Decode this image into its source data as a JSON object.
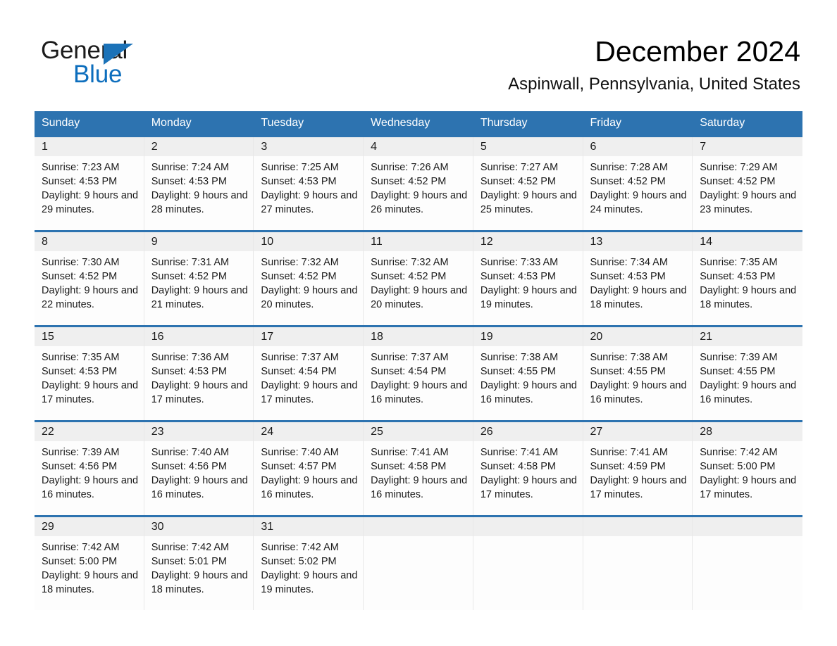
{
  "brand": {
    "logo_line1": "General",
    "logo_line2": "Blue",
    "logo_triangle_color": "#1b72b8",
    "logo_blue_text_color": "#0d6ebd"
  },
  "header": {
    "title": "December 2024",
    "subtitle": "Aspinwall, Pennsylvania, United States"
  },
  "theme": {
    "header_bar_color": "#2d73b0",
    "day_band_color": "#efefef",
    "row_divider_color": "#2d73b0",
    "cell_background": "#fdfdfd",
    "text_color": "#1b1b1b"
  },
  "calendar": {
    "weekday_headers": [
      "Sunday",
      "Monday",
      "Tuesday",
      "Wednesday",
      "Thursday",
      "Friday",
      "Saturday"
    ],
    "weeks": [
      [
        {
          "day": "1",
          "sunrise": "Sunrise: 7:23 AM",
          "sunset": "Sunset: 4:53 PM",
          "daylight": "Daylight: 9 hours and 29 minutes."
        },
        {
          "day": "2",
          "sunrise": "Sunrise: 7:24 AM",
          "sunset": "Sunset: 4:53 PM",
          "daylight": "Daylight: 9 hours and 28 minutes."
        },
        {
          "day": "3",
          "sunrise": "Sunrise: 7:25 AM",
          "sunset": "Sunset: 4:53 PM",
          "daylight": "Daylight: 9 hours and 27 minutes."
        },
        {
          "day": "4",
          "sunrise": "Sunrise: 7:26 AM",
          "sunset": "Sunset: 4:52 PM",
          "daylight": "Daylight: 9 hours and 26 minutes."
        },
        {
          "day": "5",
          "sunrise": "Sunrise: 7:27 AM",
          "sunset": "Sunset: 4:52 PM",
          "daylight": "Daylight: 9 hours and 25 minutes."
        },
        {
          "day": "6",
          "sunrise": "Sunrise: 7:28 AM",
          "sunset": "Sunset: 4:52 PM",
          "daylight": "Daylight: 9 hours and 24 minutes."
        },
        {
          "day": "7",
          "sunrise": "Sunrise: 7:29 AM",
          "sunset": "Sunset: 4:52 PM",
          "daylight": "Daylight: 9 hours and 23 minutes."
        }
      ],
      [
        {
          "day": "8",
          "sunrise": "Sunrise: 7:30 AM",
          "sunset": "Sunset: 4:52 PM",
          "daylight": "Daylight: 9 hours and 22 minutes."
        },
        {
          "day": "9",
          "sunrise": "Sunrise: 7:31 AM",
          "sunset": "Sunset: 4:52 PM",
          "daylight": "Daylight: 9 hours and 21 minutes."
        },
        {
          "day": "10",
          "sunrise": "Sunrise: 7:32 AM",
          "sunset": "Sunset: 4:52 PM",
          "daylight": "Daylight: 9 hours and 20 minutes."
        },
        {
          "day": "11",
          "sunrise": "Sunrise: 7:32 AM",
          "sunset": "Sunset: 4:52 PM",
          "daylight": "Daylight: 9 hours and 20 minutes."
        },
        {
          "day": "12",
          "sunrise": "Sunrise: 7:33 AM",
          "sunset": "Sunset: 4:53 PM",
          "daylight": "Daylight: 9 hours and 19 minutes."
        },
        {
          "day": "13",
          "sunrise": "Sunrise: 7:34 AM",
          "sunset": "Sunset: 4:53 PM",
          "daylight": "Daylight: 9 hours and 18 minutes."
        },
        {
          "day": "14",
          "sunrise": "Sunrise: 7:35 AM",
          "sunset": "Sunset: 4:53 PM",
          "daylight": "Daylight: 9 hours and 18 minutes."
        }
      ],
      [
        {
          "day": "15",
          "sunrise": "Sunrise: 7:35 AM",
          "sunset": "Sunset: 4:53 PM",
          "daylight": "Daylight: 9 hours and 17 minutes."
        },
        {
          "day": "16",
          "sunrise": "Sunrise: 7:36 AM",
          "sunset": "Sunset: 4:53 PM",
          "daylight": "Daylight: 9 hours and 17 minutes."
        },
        {
          "day": "17",
          "sunrise": "Sunrise: 7:37 AM",
          "sunset": "Sunset: 4:54 PM",
          "daylight": "Daylight: 9 hours and 17 minutes."
        },
        {
          "day": "18",
          "sunrise": "Sunrise: 7:37 AM",
          "sunset": "Sunset: 4:54 PM",
          "daylight": "Daylight: 9 hours and 16 minutes."
        },
        {
          "day": "19",
          "sunrise": "Sunrise: 7:38 AM",
          "sunset": "Sunset: 4:55 PM",
          "daylight": "Daylight: 9 hours and 16 minutes."
        },
        {
          "day": "20",
          "sunrise": "Sunrise: 7:38 AM",
          "sunset": "Sunset: 4:55 PM",
          "daylight": "Daylight: 9 hours and 16 minutes."
        },
        {
          "day": "21",
          "sunrise": "Sunrise: 7:39 AM",
          "sunset": "Sunset: 4:55 PM",
          "daylight": "Daylight: 9 hours and 16 minutes."
        }
      ],
      [
        {
          "day": "22",
          "sunrise": "Sunrise: 7:39 AM",
          "sunset": "Sunset: 4:56 PM",
          "daylight": "Daylight: 9 hours and 16 minutes."
        },
        {
          "day": "23",
          "sunrise": "Sunrise: 7:40 AM",
          "sunset": "Sunset: 4:56 PM",
          "daylight": "Daylight: 9 hours and 16 minutes."
        },
        {
          "day": "24",
          "sunrise": "Sunrise: 7:40 AM",
          "sunset": "Sunset: 4:57 PM",
          "daylight": "Daylight: 9 hours and 16 minutes."
        },
        {
          "day": "25",
          "sunrise": "Sunrise: 7:41 AM",
          "sunset": "Sunset: 4:58 PM",
          "daylight": "Daylight: 9 hours and 16 minutes."
        },
        {
          "day": "26",
          "sunrise": "Sunrise: 7:41 AM",
          "sunset": "Sunset: 4:58 PM",
          "daylight": "Daylight: 9 hours and 17 minutes."
        },
        {
          "day": "27",
          "sunrise": "Sunrise: 7:41 AM",
          "sunset": "Sunset: 4:59 PM",
          "daylight": "Daylight: 9 hours and 17 minutes."
        },
        {
          "day": "28",
          "sunrise": "Sunrise: 7:42 AM",
          "sunset": "Sunset: 5:00 PM",
          "daylight": "Daylight: 9 hours and 17 minutes."
        }
      ],
      [
        {
          "day": "29",
          "sunrise": "Sunrise: 7:42 AM",
          "sunset": "Sunset: 5:00 PM",
          "daylight": "Daylight: 9 hours and 18 minutes."
        },
        {
          "day": "30",
          "sunrise": "Sunrise: 7:42 AM",
          "sunset": "Sunset: 5:01 PM",
          "daylight": "Daylight: 9 hours and 18 minutes."
        },
        {
          "day": "31",
          "sunrise": "Sunrise: 7:42 AM",
          "sunset": "Sunset: 5:02 PM",
          "daylight": "Daylight: 9 hours and 19 minutes."
        },
        {
          "day": "",
          "sunrise": "",
          "sunset": "",
          "daylight": ""
        },
        {
          "day": "",
          "sunrise": "",
          "sunset": "",
          "daylight": ""
        },
        {
          "day": "",
          "sunrise": "",
          "sunset": "",
          "daylight": ""
        },
        {
          "day": "",
          "sunrise": "",
          "sunset": "",
          "daylight": ""
        }
      ]
    ]
  }
}
